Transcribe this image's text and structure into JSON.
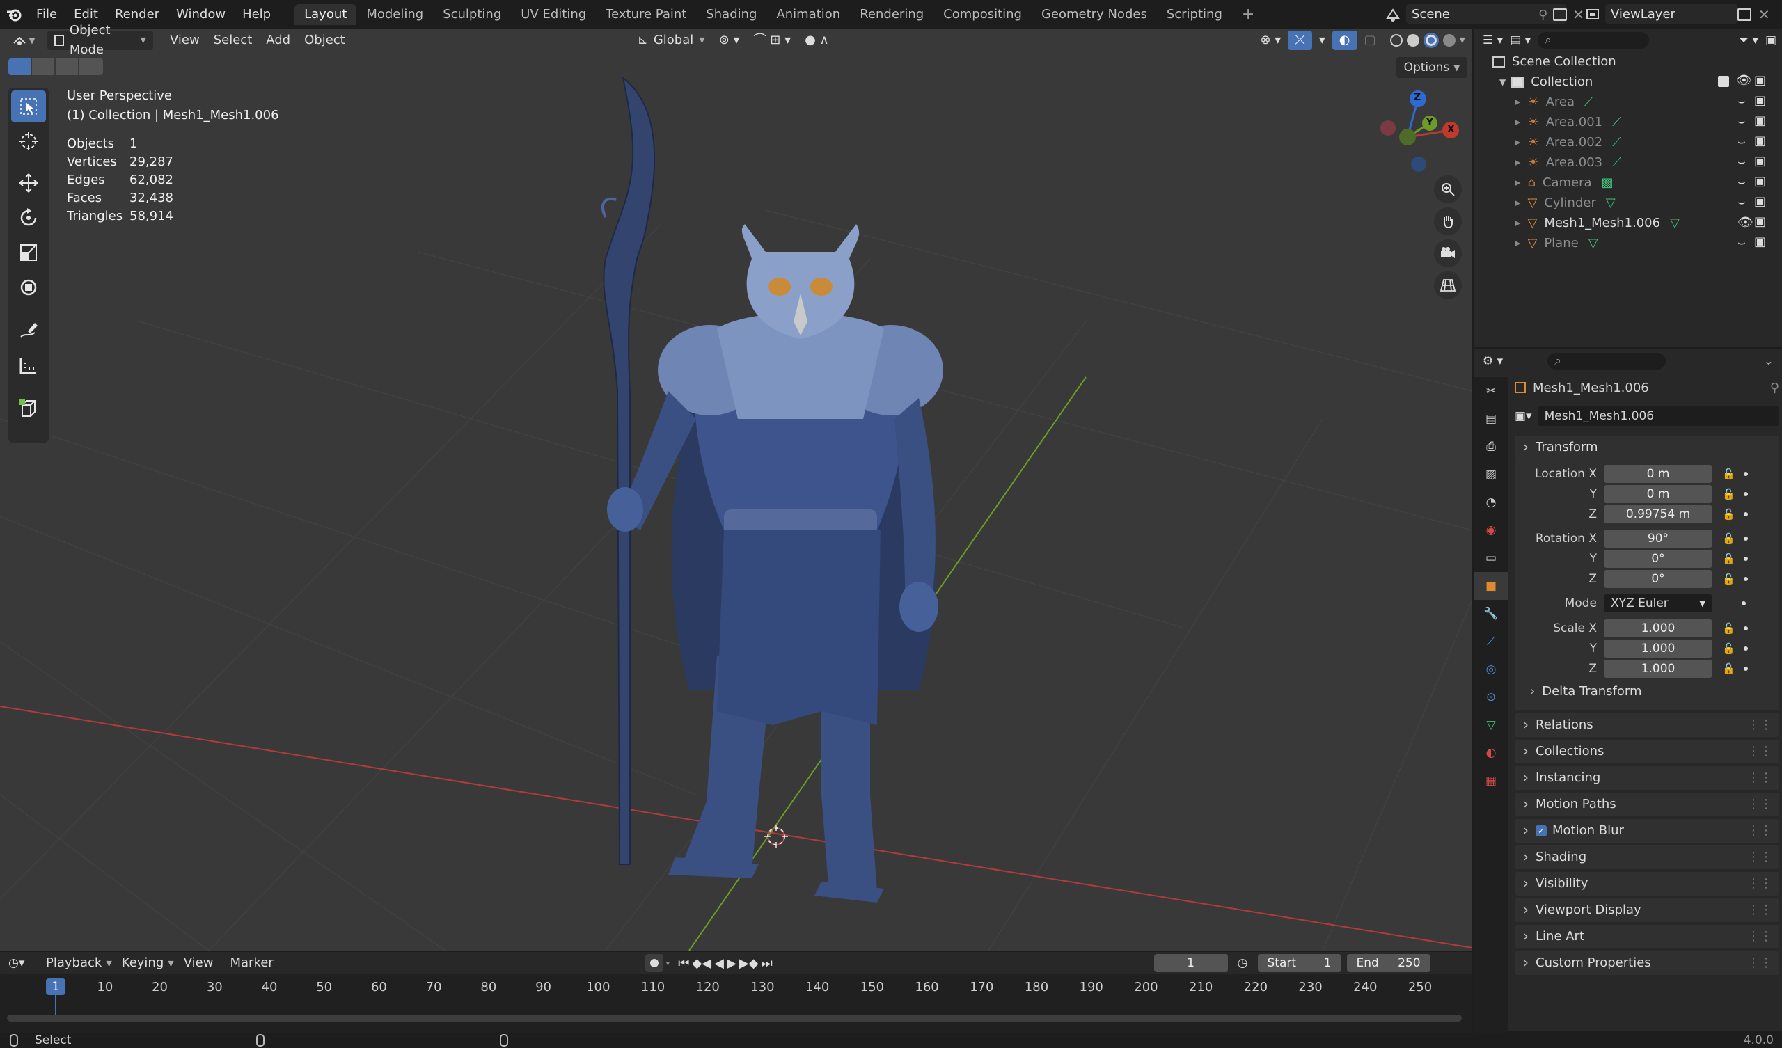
{
  "menu": [
    "File",
    "Edit",
    "Render",
    "Window",
    "Help"
  ],
  "workspaces": [
    "Layout",
    "Modeling",
    "Sculpting",
    "UV Editing",
    "Texture Paint",
    "Shading",
    "Animation",
    "Rendering",
    "Compositing",
    "Geometry Nodes",
    "Scripting"
  ],
  "active_workspace": "Layout",
  "scene": "Scene",
  "view_layer": "ViewLayer",
  "viewport_header": {
    "mode": "Object Mode",
    "menus": [
      "View",
      "Select",
      "Add",
      "Object"
    ],
    "orientation": "Global",
    "options": "Options"
  },
  "overlay_info": {
    "view_name": "User Perspective",
    "collection_line": "(1) Collection | Mesh1_Mesh1.006",
    "stats": [
      {
        "label": "Objects",
        "value": "1"
      },
      {
        "label": "Vertices",
        "value": "29,287"
      },
      {
        "label": "Edges",
        "value": "62,082"
      },
      {
        "label": "Faces",
        "value": "32,438"
      },
      {
        "label": "Triangles",
        "value": "58,914"
      }
    ]
  },
  "gizmo": {
    "z": "Z",
    "y": "Y",
    "x": "X"
  },
  "outliner": {
    "root": "Scene Collection",
    "collection": "Collection",
    "items": [
      "Area",
      "Area.001",
      "Area.002",
      "Area.003",
      "Camera",
      "Cylinder",
      "Mesh1_Mesh1.006",
      "Plane"
    ],
    "selected": "Mesh1_Mesh1.006"
  },
  "properties": {
    "object_name": "Mesh1_Mesh1.006",
    "datablock_name": "Mesh1_Mesh1.006",
    "transform_title": "Transform",
    "location_label": "Location X",
    "location": [
      "0 m",
      "0 m",
      "0.99754 m"
    ],
    "rotation_label": "Rotation X",
    "rotation": [
      "90°",
      "0°",
      "0°"
    ],
    "mode_label": "Mode",
    "mode_value": "XYZ Euler",
    "scale_label": "Scale X",
    "scale": [
      "1.000",
      "1.000",
      "1.000"
    ],
    "axis_y": "Y",
    "axis_z": "Z",
    "delta_transform": "Delta Transform",
    "panels": [
      "Relations",
      "Collections",
      "Instancing",
      "Motion Paths",
      "Motion Blur",
      "Shading",
      "Visibility",
      "Viewport Display",
      "Line Art",
      "Custom Properties"
    ]
  },
  "timeline": {
    "menus": [
      "Playback",
      "Keying",
      "View",
      "Marker"
    ],
    "current_frame": "1",
    "start_label": "Start",
    "start": "1",
    "end_label": "End",
    "end": "250",
    "ticks": [
      "10",
      "20",
      "30",
      "40",
      "50",
      "60",
      "70",
      "80",
      "90",
      "100",
      "110",
      "120",
      "130",
      "140",
      "150",
      "160",
      "170",
      "180",
      "190",
      "200",
      "210",
      "220",
      "230",
      "240",
      "250"
    ],
    "playhead": "1"
  },
  "statusbar": {
    "left": "Select",
    "version": "4.0.0"
  },
  "colors": {
    "accent": "#4772b3",
    "x_axis": "#b33a3a",
    "y_axis": "#6c9b27",
    "z_axis": "#2e6bd1",
    "mesh": "#4a6aa8"
  }
}
